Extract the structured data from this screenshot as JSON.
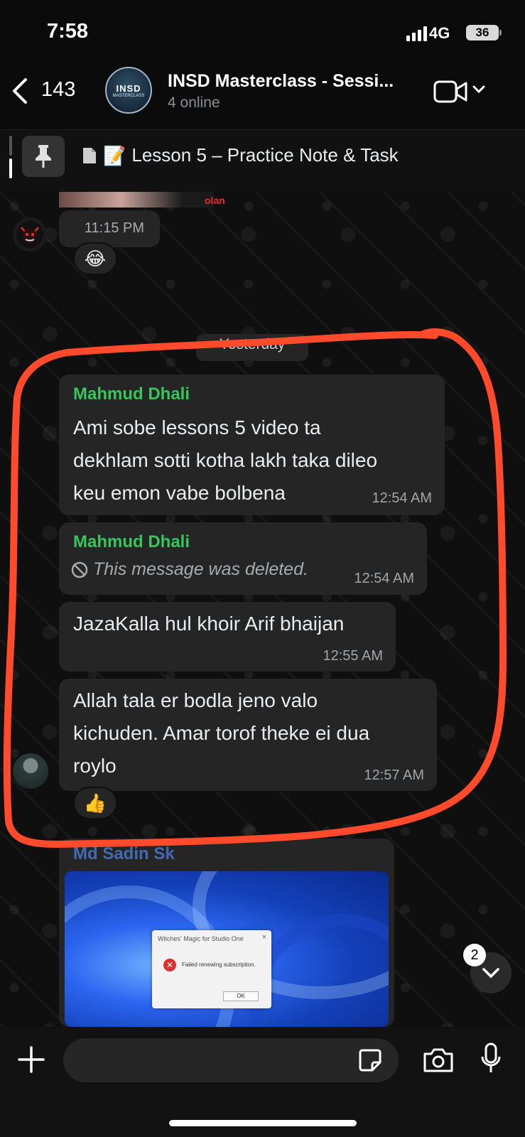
{
  "status_bar": {
    "time": "7:58",
    "network": "4G",
    "battery": "36"
  },
  "header": {
    "back_count": "143",
    "group_avatar_line1": "INSD",
    "group_avatar_line2": "MASTERCLASS",
    "title": "INSD Masterclass - Sessi...",
    "subtitle": "4 online"
  },
  "pinned": {
    "text": "Lesson 5 – Practice Note & Task"
  },
  "partial_top": {
    "text": "olan"
  },
  "first_group": {
    "time": "11:15 PM",
    "reaction": "😂"
  },
  "date_divider": "Yesterday",
  "messages": [
    {
      "sender": "Mahmud Dhali",
      "lines": [
        "Ami sobe lessons 5 video ta",
        "dekhlam sotti kotha lakh taka dileo",
        "keu emon vabe bolbena"
      ],
      "time": "12:54 AM"
    },
    {
      "sender": "Mahmud Dhali",
      "deleted_text": "This message was deleted.",
      "time": "12:54 AM"
    },
    {
      "lines": [
        "JazaKalla hul khoir Arif bhaijan"
      ],
      "time": "12:55 AM"
    },
    {
      "lines": [
        "Allah tala er bodla jeno valo",
        "kichuden. Amar torof theke ei dua",
        "roylo"
      ],
      "time": "12:57 AM",
      "reaction": "👍"
    }
  ],
  "media_message": {
    "sender": "Md Sadin Sk",
    "dialog_title": "Witches' Magic for Studio One",
    "dialog_message": "Failed renewing subscription.",
    "dialog_ok": "OK",
    "dialog_close": "×"
  },
  "scroll_button": {
    "unread": "2"
  },
  "composer": {
    "placeholder": ""
  },
  "colors": {
    "sender_green": "#35c759",
    "annotation_red": "#ff4a2b",
    "bubble": "#252525"
  }
}
